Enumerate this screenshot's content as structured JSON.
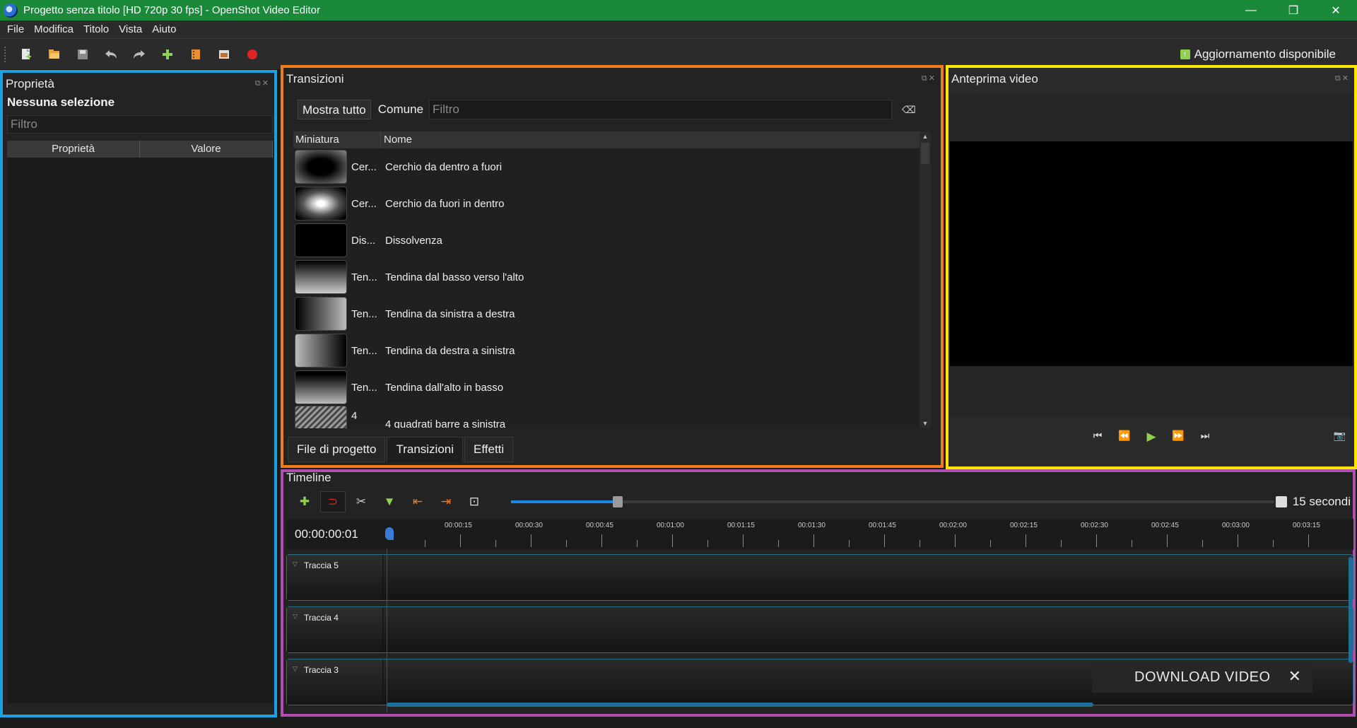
{
  "window": {
    "title": "Progetto senza titolo [HD 720p 30 fps] - OpenShot Video Editor",
    "controls": [
      "—",
      "❐",
      "✕"
    ]
  },
  "menu": [
    "File",
    "Modifica",
    "Titolo",
    "Vista",
    "Aiuto"
  ],
  "toolbar": {
    "icons": [
      "new-project-icon",
      "open-project-icon",
      "save-project-icon",
      "undo-icon",
      "redo-icon",
      "import-files-icon",
      "profile-icon",
      "fullscreen-icon",
      "export-video-icon"
    ],
    "update_label": "Aggiornamento disponibile"
  },
  "properties": {
    "title": "Proprietà",
    "no_selection": "Nessuna selezione",
    "filter_placeholder": "Filtro",
    "col_property": "Proprietà",
    "col_value": "Valore"
  },
  "transitions": {
    "title": "Transizioni",
    "show_all": "Mostra tutto",
    "common": "Comune",
    "filter_placeholder": "Filtro",
    "col_thumb": "Miniatura",
    "col_name": "Nome",
    "items": [
      {
        "short": "Cer...",
        "name": "Cerchio da dentro a fuori"
      },
      {
        "short": "Cer...",
        "name": "Cerchio da fuori in dentro"
      },
      {
        "short": "Dis...",
        "name": "Dissolvenza"
      },
      {
        "short": "Ten...",
        "name": "Tendina dal basso verso l'alto"
      },
      {
        "short": "Ten...",
        "name": "Tendina da sinistra a destra"
      },
      {
        "short": "Ten...",
        "name": "Tendina da destra a sinistra"
      },
      {
        "short": "Ten...",
        "name": "Tendina dall'alto in basso"
      },
      {
        "short": "4",
        "name": "4 quadrati barre a sinistra"
      }
    ],
    "tabs": [
      "File di progetto",
      "Transizioni",
      "Effetti"
    ],
    "active_tab": 1
  },
  "preview": {
    "title": "Anteprima video"
  },
  "timeline": {
    "title": "Timeline",
    "zoom_label": "15 secondi",
    "timecode": "00:00:00:01",
    "ticks": [
      "00:00:15",
      "00:00:30",
      "00:00:45",
      "00:01:00",
      "00:01:15",
      "00:01:30",
      "00:01:45",
      "00:02:00",
      "00:02:15",
      "00:02:30",
      "00:02:45",
      "00:03:00",
      "00:03:15"
    ],
    "tracks": [
      "Traccia 5",
      "Traccia 4",
      "Traccia 3"
    ]
  },
  "download": {
    "label": "DOWNLOAD VIDEO",
    "close": "✕"
  }
}
